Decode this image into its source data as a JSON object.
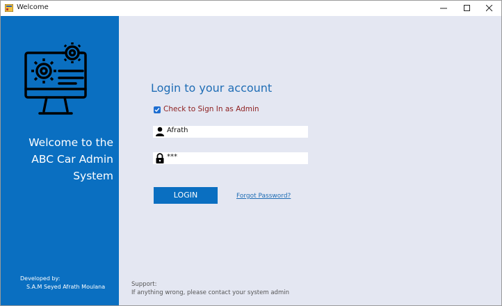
{
  "window": {
    "title": "Welcome"
  },
  "sidebar": {
    "welcome_line1": "Welcome to the",
    "welcome_line2": "ABC Car Admin",
    "welcome_line3": "System",
    "developed_by_label": "Developed by:",
    "developer_name": "S.A.M Seyed Afrath Moulana",
    "hero_icon": "computer-settings-icon",
    "color": "#0a6fc1"
  },
  "login": {
    "heading": "Login to your account",
    "admin_checkbox_label": "Check to Sign In as Admin",
    "admin_checked": true,
    "username_value": "Afrath",
    "password_value": "***",
    "login_button": "LOGIN",
    "forgot_password": "Forgot Password?"
  },
  "support": {
    "label": "Support:",
    "text": "If anything wrong, please contact your system admin"
  }
}
